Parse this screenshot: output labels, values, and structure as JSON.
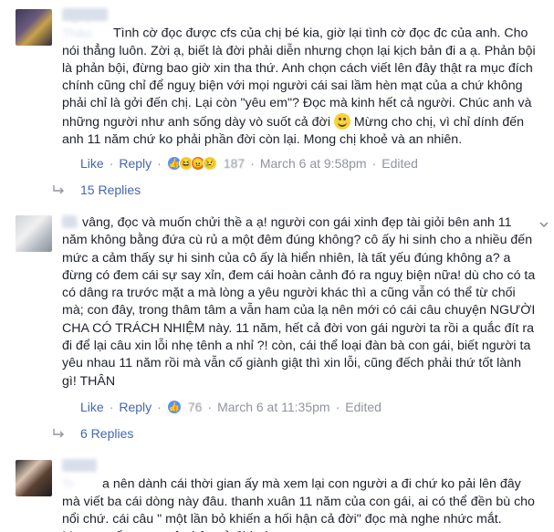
{
  "comments": [
    {
      "author": "Nguyễn Thảo",
      "text_part1": "Tình cờ đọc được cfs của chị bé kia, giờ lại tình cờ đọc đc của anh. Cho nói thẳng luôn. Zời ạ, biết là đời phải diễn nhưng chọn lại kịch bản đi a ạ. Phản bội là phản bội, đừng bao giờ xin tha thứ. Anh chọn cách viết lên đây thật ra mục đích chính cũng chỉ để nguỵ biện với mọi người cái sai lầm hèn mạt của a chứ không phải chỉ là gởi đến chị. Lại còn \"yêu em\"? Đọc mà kinh hết cả người. Chúc anh và những người như anh sống dày vò suốt cả đời",
      "emoji": "smile-emoji",
      "text_part2": " Mừng cho chị, vì chỉ dính đến anh 11 năm chứ ko phải phần đời còn lại. Mong chị khoẻ và an nhiên.",
      "like": "Like",
      "reply": "Reply",
      "reaction_count": "187",
      "timestamp": "March 6 at 9:58pm",
      "edited": "Edited",
      "replies_label": "15 Replies",
      "reactions": [
        "like-icon",
        "haha-icon",
        "angry-icon",
        "sad-icon"
      ]
    },
    {
      "author": "Hà",
      "text": "vâng, đọc và muốn chửi thề a ạ! người con gái xinh đẹp tài giỏi bên anh 11 năm không bằng đứa cù rủ a một đêm đúng không? cô ấy hi sinh cho a nhiều đến mức a cảm thấy sự hi sinh của cô ấy là hiển nhiên, là tất yếu đúng không a? a đừng có đem cái sự say xỉn, đem cái hoàn cảnh đó ra nguỵ biện nữa! dù cho có ta có dâng ra trước mặt a mà lòng a yêu người khác thì a cũng vẫn có thể từ chối mà; con đây, trong thâm tâm a vẫn ham của lạ nên mới có cái câu chuyện NGƯỜI CHA CÓ TRÁCH NHIỆM này. 11 năm, hết cả đời von gái người ta rồi a quắc đít ra đi để lại câu xin lỗi nhẹ tênh a nhỉ ?! còn, cái thể loại đàn bà con gái, biết người ta yêu nhau 11 năm rồi mà vẫn cố giành giật thì xin lỗi, cũng đếch phải thứ tốt lành gì! THÂN",
      "like": "Like",
      "reply": "Reply",
      "reaction_count": "76",
      "timestamp": "March 6 at 11:35pm",
      "edited": "Edited",
      "replies_label": "6 Replies",
      "reactions": [
        "like-icon"
      ]
    },
    {
      "author": "Thảo Tr",
      "text": "a nên dành cái thời gian ấy mà xem lại con người a đi chứ ko pải lên đây mà viết ba cái dòng này đâu. thanh xuân 11 năm của con gái, ai có thể đền bù cho nổi chứ. cái câu \" một lần bỏ khiến a hối hận cả đời\" đọc mà nghe nhức mắt. Mong a sống trong ân hận cả đời này"
    }
  ],
  "colors": {
    "link": "#4267b2",
    "meta": "#90949c",
    "text": "#1d2129"
  }
}
